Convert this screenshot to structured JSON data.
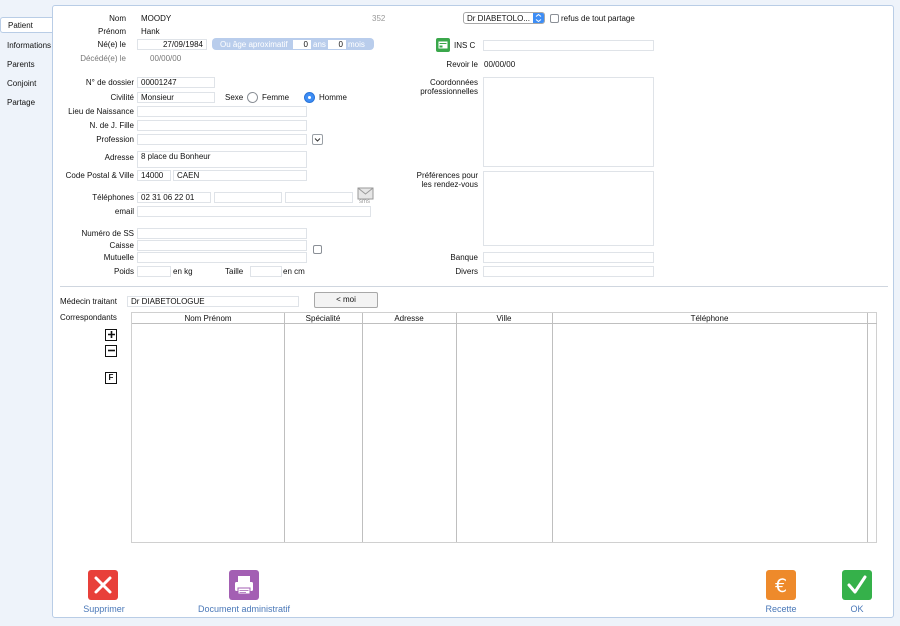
{
  "sidebar": {
    "tabs": [
      "Patient",
      "Informations",
      "Parents",
      "Conjoint",
      "Partage"
    ]
  },
  "identity": {
    "nom_label": "Nom",
    "nom": "MOODY",
    "prenom_label": "Prénom",
    "prenom": "Hank",
    "ne_label": "Né(e) le",
    "ne": "27/09/1984",
    "age_label": "Ou âge aproximatif",
    "age_ans": "0",
    "ans_unit": "ans",
    "age_mois": "0",
    "mois_unit": "mois",
    "decede_label": "Décédé(e) le",
    "decede": "00/00/00",
    "record_number": "352"
  },
  "doctor_select": {
    "value": "Dr DIABETOLO...",
    "refus_label": "refus de tout partage"
  },
  "insc": {
    "label": "INS C",
    "value": ""
  },
  "revoir": {
    "label": "Revoir le",
    "value": "00/00/00"
  },
  "dossier": {
    "num_label": "N° de dossier",
    "num": "00001247",
    "civilite_label": "Civilité",
    "civilite": "Monsieur",
    "sexe_label": "Sexe",
    "femme": "Femme",
    "homme": "Homme",
    "lieu_label": "Lieu de Naissance",
    "lieu": "",
    "fille_label": "N. de J. Fille",
    "fille": "",
    "profession_label": "Profession",
    "profession": "",
    "adresse_label": "Adresse",
    "adresse": "8 place du Bonheur",
    "cp_label": "Code Postal & Ville",
    "cp": "14000",
    "ville": "CAEN",
    "tel_label": "Téléphones",
    "tel1": "02 31 06 22 01",
    "tel2": "",
    "tel3": "",
    "sms_label": "sms",
    "email_label": "email",
    "email": ""
  },
  "social": {
    "ss_label": "Numéro de SS",
    "ss": "",
    "caisse_label": "Caisse",
    "caisse": "",
    "mutuelle_label": "Mutuelle",
    "mutuelle": "",
    "poids_label": "Poids",
    "poids_unit": "en kg",
    "taille_label": "Taille",
    "taille_unit": "en cm"
  },
  "right": {
    "coord_label": "Coordonnées professionnelles",
    "pref_label": "Préférences pour les rendez-vous",
    "banque_label": "Banque",
    "divers_label": "Divers"
  },
  "medecin": {
    "label": "Médecin traitant",
    "value": "Dr DIABETOLOGUE",
    "moi_button": "< moi"
  },
  "correspondants": {
    "label": "Correspondants",
    "columns": [
      "Nom Prénom",
      "Spécialité",
      "Adresse",
      "Ville",
      "Téléphone"
    ],
    "f_button": "F"
  },
  "footer": {
    "supprimer": "Supprimer",
    "document": "Document administratif",
    "recette": "Recette",
    "ok": "OK"
  },
  "colors": {
    "accent": "#3d8df5",
    "delete": "#e8403a",
    "print": "#a35fb3",
    "recette": "#ee8a2b",
    "ok": "#35b14a",
    "caption": "#4a78b8"
  }
}
